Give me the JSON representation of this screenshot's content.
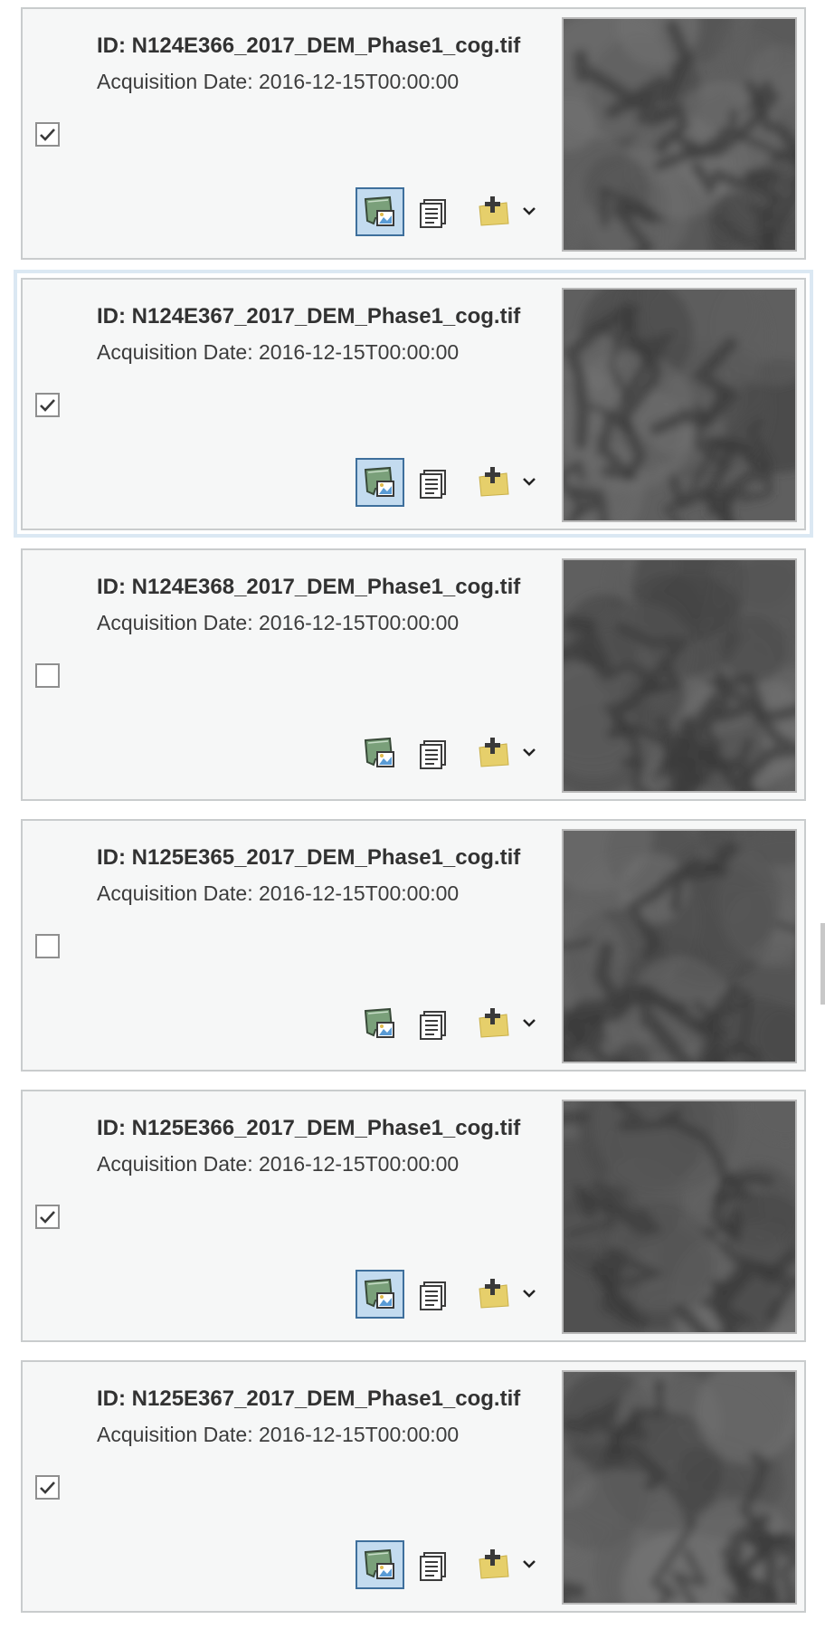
{
  "items": [
    {
      "id": "ID: N124E366_2017_DEM_Phase1_cog.tif",
      "date": "Acquisition Date: 2016-12-15T00:00:00",
      "checked": true,
      "footprint_active": true
    },
    {
      "id": "ID: N124E367_2017_DEM_Phase1_cog.tif",
      "date": "Acquisition Date: 2016-12-15T00:00:00",
      "checked": true,
      "footprint_active": true
    },
    {
      "id": "ID: N124E368_2017_DEM_Phase1_cog.tif",
      "date": "Acquisition Date: 2016-12-15T00:00:00",
      "checked": false,
      "footprint_active": false
    },
    {
      "id": "ID: N125E365_2017_DEM_Phase1_cog.tif",
      "date": "Acquisition Date: 2016-12-15T00:00:00",
      "checked": false,
      "footprint_active": false
    },
    {
      "id": "ID: N125E366_2017_DEM_Phase1_cog.tif",
      "date": "Acquisition Date: 2016-12-15T00:00:00",
      "checked": true,
      "footprint_active": true
    },
    {
      "id": "ID: N125E367_2017_DEM_Phase1_cog.tif",
      "date": "Acquisition Date: 2016-12-15T00:00:00",
      "checked": true,
      "footprint_active": true
    }
  ],
  "icons": {
    "footprint": "map-footprint-icon",
    "details": "details-icon",
    "add_to_map": "add-to-map-icon",
    "dropdown": "chevron-down-icon",
    "checkbox": "checkmark-icon"
  },
  "colors": {
    "card_bg": "#f6f7f7",
    "card_border": "#c9cccd",
    "active_button_bg": "#c3dbef",
    "active_button_border": "#3e6f9c",
    "selection_highlight": "#dbe8f3"
  }
}
